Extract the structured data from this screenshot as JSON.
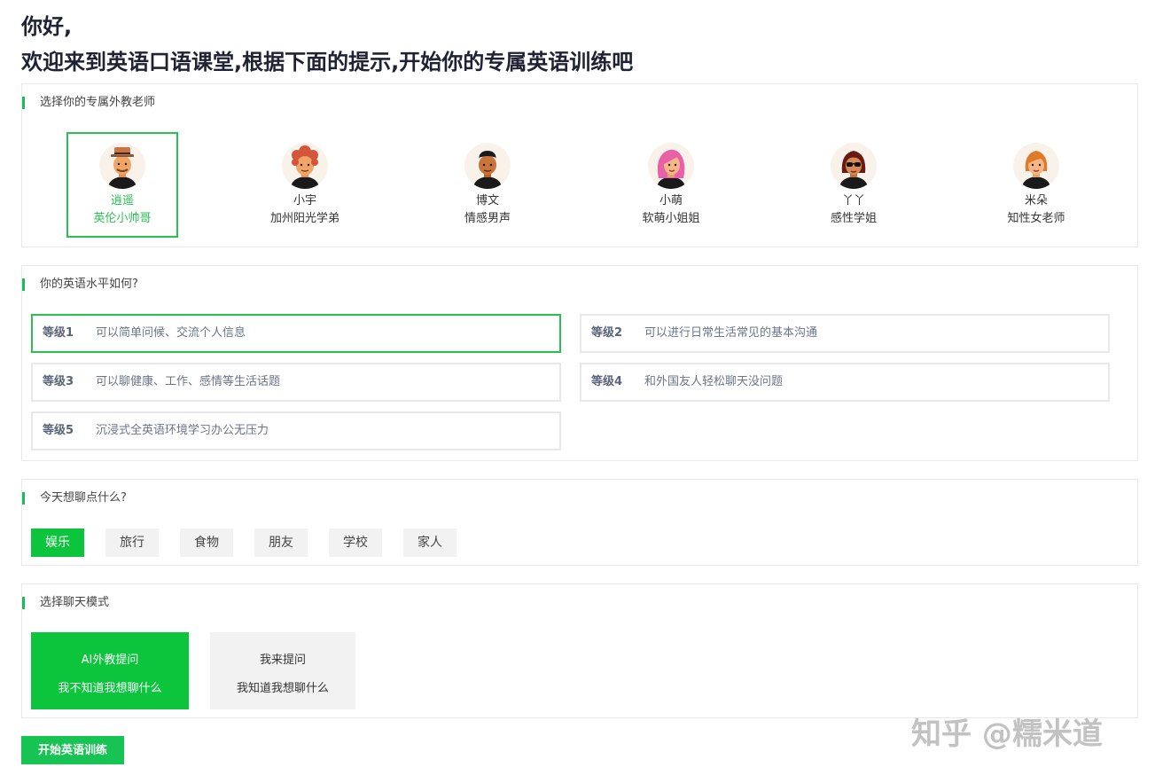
{
  "greeting": {
    "line1": "你好,",
    "line2": "欢迎来到英语口语课堂,根据下面的提示,开始你的专属英语训练吧"
  },
  "teachers": {
    "title": "选择你的专属外教老师",
    "items": [
      {
        "name": "逍遥",
        "desc": "英伦小帅哥",
        "selected": true
      },
      {
        "name": "小宇",
        "desc": "加州阳光学弟",
        "selected": false
      },
      {
        "name": "博文",
        "desc": "情感男声",
        "selected": false
      },
      {
        "name": "小萌",
        "desc": "软萌小姐姐",
        "selected": false
      },
      {
        "name": "丫丫",
        "desc": "感性学姐",
        "selected": false
      },
      {
        "name": "米朵",
        "desc": "知性女老师",
        "selected": false
      }
    ]
  },
  "levels": {
    "title": "你的英语水平如何?",
    "items": [
      {
        "tag": "等级1",
        "desc": "可以简单问候、交流个人信息",
        "selected": true
      },
      {
        "tag": "等级2",
        "desc": "可以进行日常生活常见的基本沟通",
        "selected": false
      },
      {
        "tag": "等级3",
        "desc": "可以聊健康、工作、感情等生活话题",
        "selected": false
      },
      {
        "tag": "等级4",
        "desc": "和外国友人轻松聊天没问题",
        "selected": false
      },
      {
        "tag": "等级5",
        "desc": "沉浸式全英语环境学习办公无压力",
        "selected": false
      }
    ]
  },
  "topics": {
    "title": "今天想聊点什么?",
    "items": [
      "娱乐",
      "旅行",
      "食物",
      "朋友",
      "学校",
      "家人"
    ],
    "selected": "娱乐"
  },
  "modes": {
    "title": "选择聊天模式",
    "items": [
      {
        "label": "AI外教提问",
        "desc": "我不知道我想聊什么",
        "selected": true
      },
      {
        "label": "我来提问",
        "desc": "我知道我想聊什么",
        "selected": false
      }
    ]
  },
  "start_button": "开始英语训练",
  "watermark": "知乎 @糯米道",
  "colors": {
    "accent": "#0dc43d",
    "selected_border": "#2ac152",
    "heading": "#1f2233"
  }
}
